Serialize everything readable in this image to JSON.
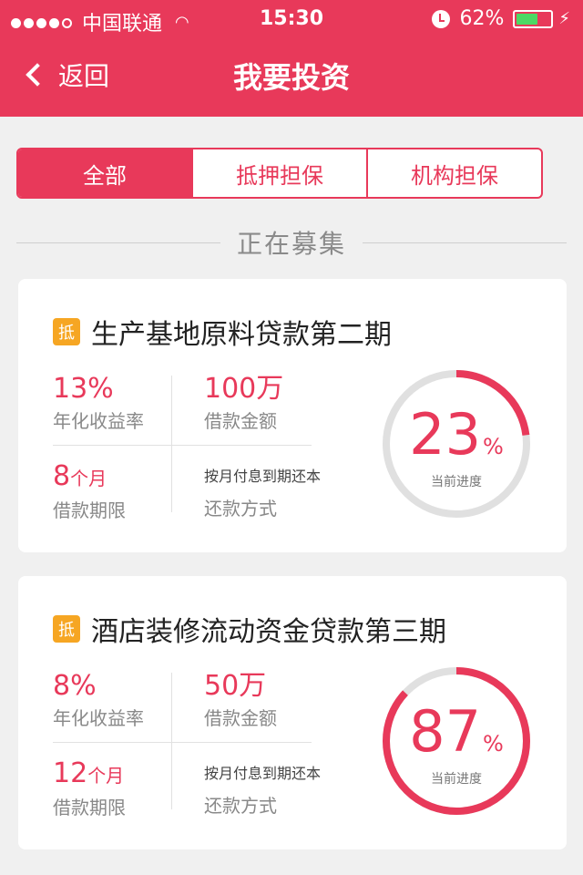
{
  "status_bar": {
    "carrier": "中国联通",
    "time": "15:30",
    "battery": "62%"
  },
  "nav": {
    "back_label": "返回",
    "title": "我要投资"
  },
  "tabs": [
    {
      "label": "全部",
      "active": true
    },
    {
      "label": "抵押担保",
      "active": false
    },
    {
      "label": "机构担保",
      "active": false
    }
  ],
  "section_title": "正在募集",
  "cards": [
    {
      "badge": "抵",
      "title": "生产基地原料贷款第二期",
      "rate_value": "13%",
      "rate_label": "年化收益率",
      "amount_value": "100万",
      "amount_label": "借款金额",
      "term_value": "8",
      "term_unit": "个月",
      "term_label": "借款期限",
      "method_value": "按月付息到期还本",
      "method_label": "还款方式",
      "progress": 23,
      "progress_unit": "%",
      "progress_label": "当前进度"
    },
    {
      "badge": "抵",
      "title": "酒店装修流动资金贷款第三期",
      "rate_value": "8%",
      "rate_label": "年化收益率",
      "amount_value": "50万",
      "amount_label": "借款金额",
      "term_value": "12",
      "term_unit": "个月",
      "term_label": "借款期限",
      "method_value": "按月付息到期还本",
      "method_label": "还款方式",
      "progress": 87,
      "progress_unit": "%",
      "progress_label": "当前进度"
    }
  ],
  "colors": {
    "accent": "#e8395a",
    "badge": "#f6a623",
    "ring_track": "#e0e0e0"
  }
}
